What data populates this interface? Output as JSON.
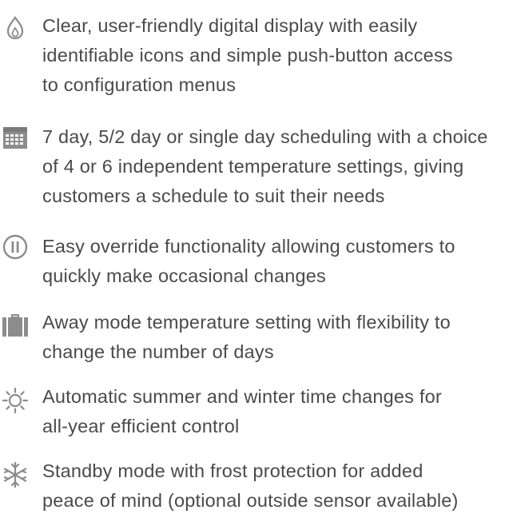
{
  "features": [
    {
      "icon": "flame-icon",
      "lines": [
        "Clear, user-friendly digital display with easily",
        "identifiable icons and simple push-button access",
        "to configuration menus"
      ]
    },
    {
      "icon": "calendar-icon",
      "lines": [
        "7 day, 5/2 day or single day scheduling with a choice",
        "of 4 or 6 independent temperature settings, giving",
        "customers a schedule to suit their needs"
      ]
    },
    {
      "icon": "pause-override-icon",
      "lines": [
        "Easy override functionality allowing customers to",
        "quickly make occasional changes"
      ]
    },
    {
      "icon": "suitcase-icon",
      "lines": [
        "Away mode temperature setting with flexibility to",
        "change the number of days"
      ]
    },
    {
      "icon": "sun-icon",
      "lines": [
        "Automatic summer and winter time changes for",
        "all-year efficient control"
      ]
    },
    {
      "icon": "snowflake-icon",
      "lines": [
        "Standby mode with frost protection for added",
        "peace of mind (optional outside sensor available)"
      ]
    }
  ],
  "colors": {
    "text": "#4a4a4a",
    "icon": "#8c8c8c"
  }
}
